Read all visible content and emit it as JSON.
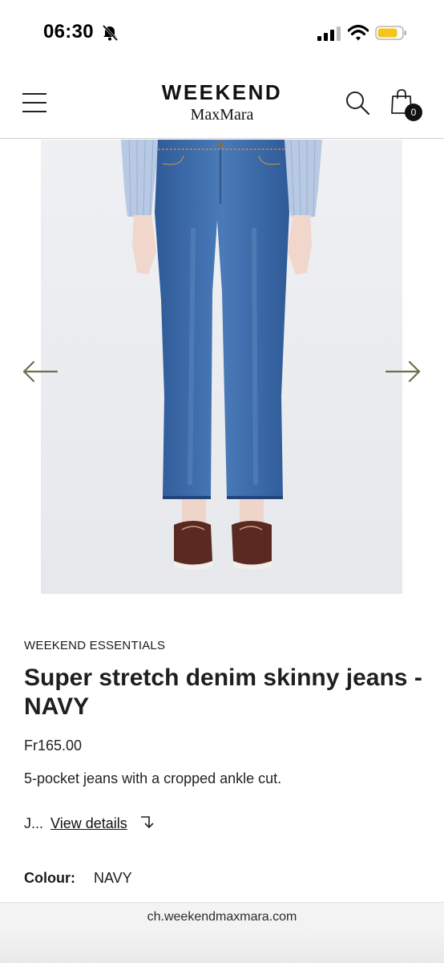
{
  "status_bar": {
    "time": "06:30"
  },
  "header": {
    "logo_top": "WEEKEND",
    "logo_bottom": "MaxMara",
    "cart_count": "0"
  },
  "product": {
    "collection": "WEEKEND ESSENTIALS",
    "title": "Super stretch denim skinny jeans - NAVY",
    "price": "Fr165.00",
    "description": "5-pocket jeans with a cropped ankle cut.",
    "details_prefix": "J...",
    "details_link": "View details",
    "colour_label": "Colour:",
    "colour_value": "NAVY"
  },
  "browser": {
    "url": "ch.weekendmaxmara.com"
  },
  "colors": {
    "arrow": "#6b6f4e",
    "denim": "#3d6aa8",
    "battery": "#f4c51c"
  }
}
